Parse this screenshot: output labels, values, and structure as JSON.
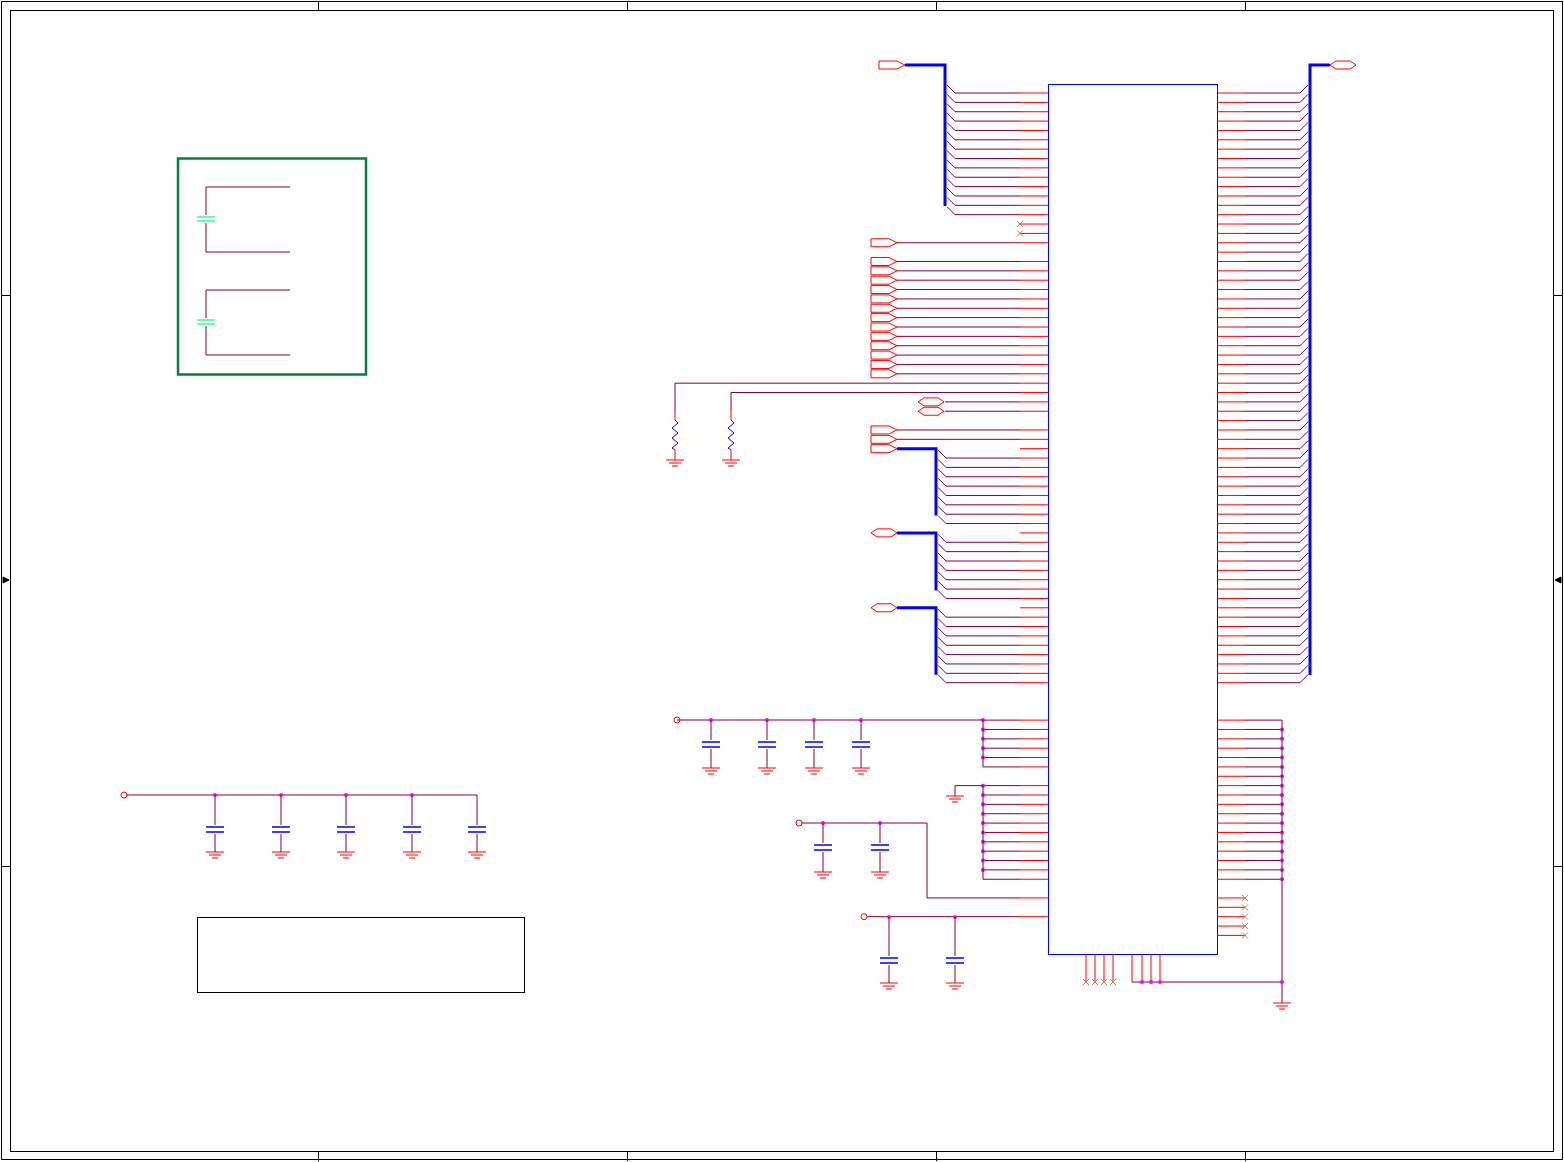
{
  "sheet": {
    "kind": "schematic"
  }
}
